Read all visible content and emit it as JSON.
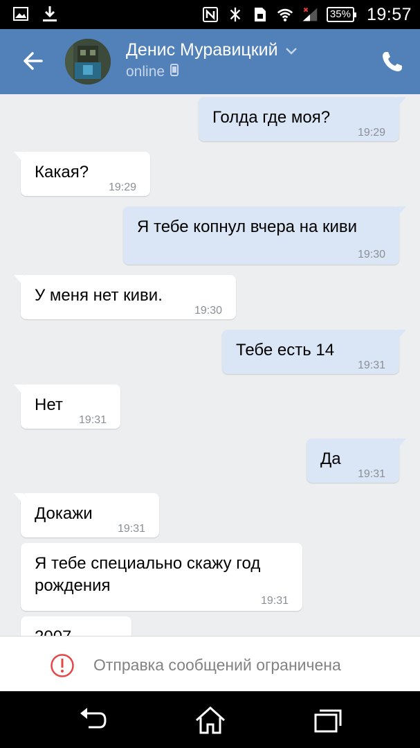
{
  "status_bar": {
    "time": "19:57",
    "battery": "35%",
    "icons": [
      "image-icon",
      "download-icon",
      "nfc-icon",
      "bluetooth-icon",
      "sim-icon",
      "wifi-icon",
      "signal-icon",
      "battery-icon"
    ]
  },
  "header": {
    "contact_name": "Денис Муравицкий",
    "status": "online",
    "accent_color": "#5181b8"
  },
  "messages": [
    {
      "direction": "out",
      "text": "Голда где моя?",
      "time": "19:29"
    },
    {
      "direction": "in",
      "text": "Какая?",
      "time": "19:29"
    },
    {
      "direction": "out",
      "text": "Я тебе копнул вчера на киви",
      "time": "19:30"
    },
    {
      "direction": "in",
      "text": "У меня нет киви.",
      "time": "19:30"
    },
    {
      "direction": "out",
      "text": "Тебе есть 14",
      "time": "19:31"
    },
    {
      "direction": "in",
      "text": "Нет",
      "time": "19:31"
    },
    {
      "direction": "out",
      "text": "Да",
      "time": "19:31"
    },
    {
      "direction": "in",
      "text": "Докажи",
      "time": "19:31"
    },
    {
      "direction": "in",
      "text_line1": "Я тебе специально скажу год",
      "text_line2": "рождения",
      "time": "19:31"
    },
    {
      "direction": "in",
      "text": "2007",
      "time": ""
    }
  ],
  "restriction": {
    "text": "Отправка сообщений ограничена",
    "icon": "exclamation-circle-icon",
    "icon_color": "#e64646"
  },
  "nav": {
    "icons": [
      "back-icon",
      "home-icon",
      "recents-icon"
    ]
  }
}
